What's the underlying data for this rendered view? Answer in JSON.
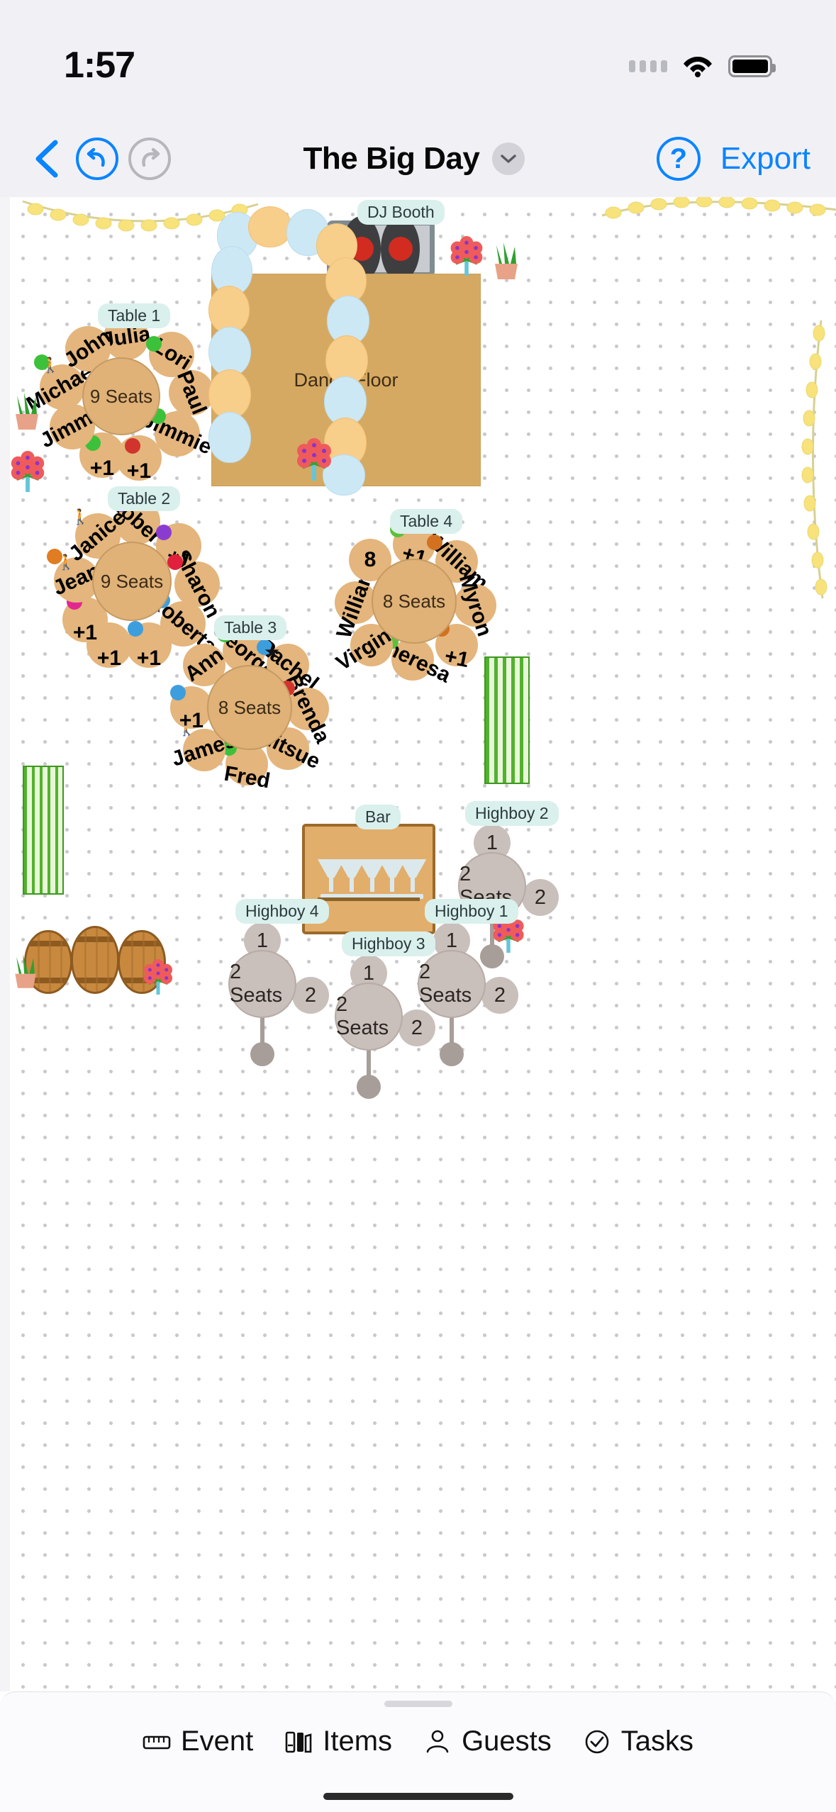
{
  "status_bar": {
    "time": "1:57",
    "signal_icon": "signal-dots-icon",
    "wifi_icon": "wifi-icon",
    "battery_icon": "battery-full-icon"
  },
  "toolbar": {
    "back_icon": "chevron-left-icon",
    "undo_icon": "undo-icon",
    "redo_icon": "redo-icon",
    "title": "The Big Day",
    "title_chevron_icon": "chevron-down-icon",
    "help_label": "?",
    "export_label": "Export",
    "accent_color": "#0a84ff",
    "disabled_color": "#b6b6bc"
  },
  "canvas": {
    "dance_floor_label": "Dance Floor",
    "dj_booth_label": "DJ Booth",
    "bar_label": "Bar",
    "tables": [
      {
        "name": "Table 1",
        "center_label": "9 Seats",
        "seats": [
          {
            "label": "Julia",
            "dot": null,
            "walker": false,
            "star": false
          },
          {
            "label": "Lori",
            "dot": "#3cc13b",
            "walker": false,
            "star": false
          },
          {
            "label": "Paul",
            "dot": null,
            "walker": false,
            "star": false
          },
          {
            "label": "Jimmie",
            "dot": "#3cc13b",
            "walker": false,
            "star": false
          },
          {
            "label": "+1",
            "dot": "#d0342c",
            "walker": false,
            "star": false
          },
          {
            "label": "+1",
            "dot": "#3cc13b",
            "walker": false,
            "star": false
          },
          {
            "label": "Jimmy",
            "dot": null,
            "walker": false,
            "star": false
          },
          {
            "label": "Michael",
            "dot": "#3cc13b",
            "walker": true,
            "star": false
          },
          {
            "label": "John",
            "dot": null,
            "walker": false,
            "star": false
          }
        ]
      },
      {
        "name": "Table 2",
        "center_label": "9 Seats",
        "seats": [
          {
            "label": "Robert",
            "dot": "#8b3cd0",
            "walker": false,
            "star": false
          },
          {
            "label": "+1",
            "dot": "#8b3cd0",
            "walker": false,
            "star": false
          },
          {
            "label": "Sharon",
            "dot": "#e0203c",
            "walker": false,
            "star": false
          },
          {
            "label": "Roberta",
            "dot": "#3d9ede",
            "walker": false,
            "star": false
          },
          {
            "label": "+1",
            "dot": "#3d9ede",
            "walker": false,
            "star": false
          },
          {
            "label": "+1",
            "dot": "#d2711f",
            "walker": false,
            "star": false
          },
          {
            "label": "+1",
            "dot": "#e2288f",
            "walker": false,
            "star": false
          },
          {
            "label": "Jean",
            "dot": "#e07d22",
            "walker": true,
            "star": false
          },
          {
            "label": "Janice",
            "dot": null,
            "walker": true,
            "star": false
          }
        ]
      },
      {
        "name": "Table 3",
        "center_label": "8 Seats",
        "seats": [
          {
            "label": "George",
            "dot": "#3cc13b",
            "walker": false,
            "star": false
          },
          {
            "label": "Rachel",
            "dot": "#3d9ede",
            "walker": false,
            "star": true
          },
          {
            "label": "Brenda",
            "dot": "#d0342c",
            "walker": false,
            "star": false
          },
          {
            "label": "Mitsue",
            "dot": "#e06423",
            "walker": true,
            "star": false
          },
          {
            "label": "Fred",
            "dot": "#3cc13b",
            "walker": false,
            "star": false
          },
          {
            "label": "James",
            "dot": null,
            "walker": true,
            "star": false
          },
          {
            "label": "+1",
            "dot": "#3d9ede",
            "walker": false,
            "star": false
          },
          {
            "label": "Ann",
            "dot": null,
            "walker": false,
            "star": false
          }
        ]
      },
      {
        "name": "Table 4",
        "center_label": "8 Seats",
        "seats": [
          {
            "label": "+1",
            "dot": "#5cc13b",
            "walker": false,
            "star": false
          },
          {
            "label": "William",
            "dot": "#d2711f",
            "walker": false,
            "star": false
          },
          {
            "label": "Myron",
            "dot": null,
            "walker": false,
            "star": false
          },
          {
            "label": "+1",
            "dot": "#d2711f",
            "walker": false,
            "star": false
          },
          {
            "label": "Theresa",
            "dot": "#5cc13b",
            "walker": false,
            "star": false
          },
          {
            "label": "Virginia",
            "dot": null,
            "walker": false,
            "star": false
          },
          {
            "label": "William",
            "dot": null,
            "walker": false,
            "star": false
          },
          {
            "label": "8",
            "dot": null,
            "walker": false,
            "star": false
          }
        ]
      }
    ],
    "highboys": [
      {
        "name": "Highboy 1",
        "center_label": "2 Seats",
        "stool_top": "1",
        "stool_side": "2"
      },
      {
        "name": "Highboy 2",
        "center_label": "2 Seats",
        "stool_top": "1",
        "stool_side": "2"
      },
      {
        "name": "Highboy 3",
        "center_label": "2 Seats",
        "stool_top": "1",
        "stool_side": "2"
      },
      {
        "name": "Highboy 4",
        "center_label": "2 Seats",
        "stool_top": "1",
        "stool_side": "2"
      }
    ],
    "decor": {
      "balloon_arch_icon": "balloon-arch-icon",
      "string_lights_icon": "string-lights-icon",
      "hedge_icon": "hedge-panel-icon",
      "barrel_icon": "wine-barrel-icon",
      "bouquet_icon": "flower-bouquet-icon",
      "plant_icon": "potted-plant-icon"
    },
    "colors": {
      "table_fill": "#e0b278",
      "seat_fill": "#e4b57c",
      "dance_floor": "#d6a962",
      "label_pill": "#daf0ec",
      "highboy_fill": "#c9bfbb"
    }
  },
  "tab_bar": {
    "tabs": [
      {
        "label": "Event",
        "icon": "ruler-icon"
      },
      {
        "label": "Items",
        "icon": "furniture-icon"
      },
      {
        "label": "Guests",
        "icon": "person-icon"
      },
      {
        "label": "Tasks",
        "icon": "check-circle-icon"
      }
    ]
  }
}
